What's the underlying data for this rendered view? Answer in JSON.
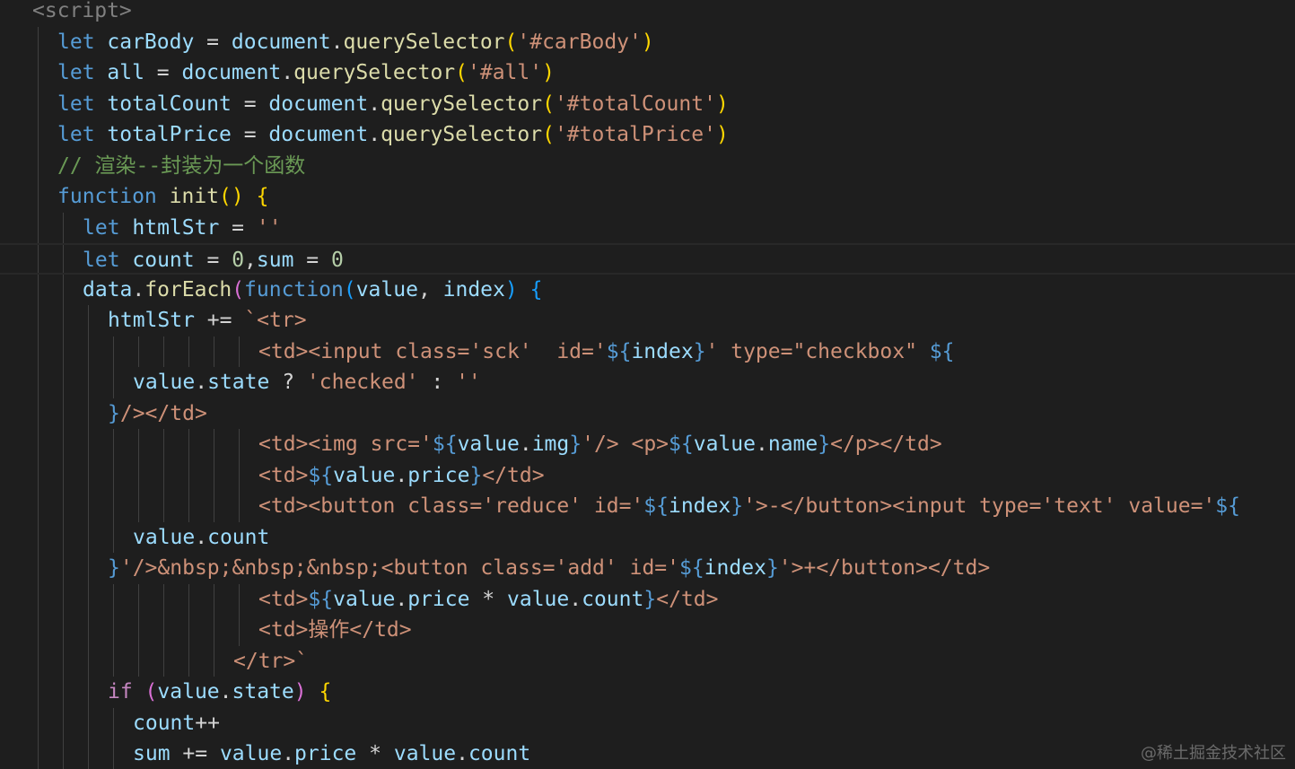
{
  "colors": {
    "background": "#1e1e1e",
    "tag": "#808080",
    "keyword": "#569cd6",
    "variable": "#9cdcfe",
    "function": "#dcdcaa",
    "string": "#ce9178",
    "number": "#b5cea8",
    "comment": "#6a9955",
    "bracket_gold": "#ffd700",
    "bracket_orchid": "#da70d6",
    "bracket_blue": "#179fff",
    "control": "#c586c0"
  },
  "watermark": "@稀土掘金技术社区",
  "current_line": 8,
  "lines": [
    {
      "indent": 1,
      "guides": [],
      "tokens": [
        [
          "tag",
          "<script>"
        ]
      ]
    },
    {
      "indent": 2,
      "guides": [
        1
      ],
      "tokens": [
        [
          "keyword",
          "let "
        ],
        [
          "var",
          "carBody"
        ],
        [
          "op",
          " = "
        ],
        [
          "var",
          "document"
        ],
        [
          "punc",
          "."
        ],
        [
          "func",
          "querySelector"
        ],
        [
          "brace",
          "("
        ],
        [
          "string",
          "'#carBody'"
        ],
        [
          "brace",
          ")"
        ]
      ]
    },
    {
      "indent": 2,
      "guides": [
        1
      ],
      "tokens": [
        [
          "keyword",
          "let "
        ],
        [
          "var",
          "all"
        ],
        [
          "op",
          " = "
        ],
        [
          "var",
          "document"
        ],
        [
          "punc",
          "."
        ],
        [
          "func",
          "querySelector"
        ],
        [
          "brace",
          "("
        ],
        [
          "string",
          "'#all'"
        ],
        [
          "brace",
          ")"
        ]
      ]
    },
    {
      "indent": 2,
      "guides": [
        1
      ],
      "tokens": [
        [
          "keyword",
          "let "
        ],
        [
          "var",
          "totalCount"
        ],
        [
          "op",
          " = "
        ],
        [
          "var",
          "document"
        ],
        [
          "punc",
          "."
        ],
        [
          "func",
          "querySelector"
        ],
        [
          "brace",
          "("
        ],
        [
          "string",
          "'#totalCount'"
        ],
        [
          "brace",
          ")"
        ]
      ]
    },
    {
      "indent": 2,
      "guides": [
        1
      ],
      "tokens": [
        [
          "keyword",
          "let "
        ],
        [
          "var",
          "totalPrice"
        ],
        [
          "op",
          " = "
        ],
        [
          "var",
          "document"
        ],
        [
          "punc",
          "."
        ],
        [
          "func",
          "querySelector"
        ],
        [
          "brace",
          "("
        ],
        [
          "string",
          "'#totalPrice'"
        ],
        [
          "brace",
          ")"
        ]
      ]
    },
    {
      "indent": 2,
      "guides": [
        1
      ],
      "tokens": [
        [
          "comment",
          "// 渲染--封装为一个函数"
        ]
      ]
    },
    {
      "indent": 2,
      "guides": [
        1
      ],
      "tokens": [
        [
          "keyword",
          "function "
        ],
        [
          "func",
          "init"
        ],
        [
          "brace",
          "()"
        ],
        [
          "punc",
          " "
        ],
        [
          "brace",
          "{"
        ]
      ]
    },
    {
      "indent": 3,
      "guides": [
        1,
        2
      ],
      "tokens": [
        [
          "keyword",
          "let "
        ],
        [
          "var",
          "htmlStr"
        ],
        [
          "op",
          " = "
        ],
        [
          "string",
          "''"
        ]
      ]
    },
    {
      "indent": 3,
      "guides": [
        1,
        2
      ],
      "tokens": [
        [
          "keyword",
          "let "
        ],
        [
          "var",
          "count"
        ],
        [
          "op",
          " = "
        ],
        [
          "number",
          "0"
        ],
        [
          "punc",
          ","
        ],
        [
          "var",
          "sum"
        ],
        [
          "op",
          " = "
        ],
        [
          "number",
          "0"
        ]
      ]
    },
    {
      "indent": 3,
      "guides": [
        1,
        2
      ],
      "tokens": [
        [
          "var",
          "data"
        ],
        [
          "punc",
          "."
        ],
        [
          "func",
          "forEach"
        ],
        [
          "paren",
          "("
        ],
        [
          "keyword",
          "function"
        ],
        [
          "paren2",
          "("
        ],
        [
          "var",
          "value"
        ],
        [
          "punc",
          ", "
        ],
        [
          "var",
          "index"
        ],
        [
          "paren2",
          ")"
        ],
        [
          "punc",
          " "
        ],
        [
          "paren2",
          "{"
        ]
      ]
    },
    {
      "indent": 4,
      "guides": [
        1,
        2,
        3
      ],
      "tokens": [
        [
          "var",
          "htmlStr"
        ],
        [
          "op",
          " += "
        ],
        [
          "string",
          "`<tr>"
        ]
      ]
    },
    {
      "indent": 10,
      "guides": [
        1,
        2,
        3,
        4,
        5,
        6,
        7,
        8,
        9
      ],
      "tokens": [
        [
          "string",
          "<td><input class='sck'  id='"
        ],
        [
          "interp",
          "${"
        ],
        [
          "var",
          "index"
        ],
        [
          "interp",
          "}"
        ],
        [
          "string",
          "' type=\"checkbox\" "
        ],
        [
          "interp",
          "${"
        ]
      ]
    },
    {
      "indent": 5,
      "guides": [
        1,
        2,
        3,
        4
      ],
      "tokens": [
        [
          "var",
          "value"
        ],
        [
          "punc",
          "."
        ],
        [
          "var",
          "state"
        ],
        [
          "op",
          " ? "
        ],
        [
          "string",
          "'checked'"
        ],
        [
          "op",
          " : "
        ],
        [
          "string",
          "''"
        ]
      ]
    },
    {
      "indent": 4,
      "guides": [
        1,
        2,
        3
      ],
      "tokens": [
        [
          "interp",
          "}"
        ],
        [
          "string",
          "/></td>"
        ]
      ]
    },
    {
      "indent": 10,
      "guides": [
        1,
        2,
        3,
        4,
        5,
        6,
        7,
        8,
        9
      ],
      "tokens": [
        [
          "string",
          "<td><img src='"
        ],
        [
          "interp",
          "${"
        ],
        [
          "var",
          "value"
        ],
        [
          "punc",
          "."
        ],
        [
          "var",
          "img"
        ],
        [
          "interp",
          "}"
        ],
        [
          "string",
          "'/> <p>"
        ],
        [
          "interp",
          "${"
        ],
        [
          "var",
          "value"
        ],
        [
          "punc",
          "."
        ],
        [
          "var",
          "name"
        ],
        [
          "interp",
          "}"
        ],
        [
          "string",
          "</p></td>"
        ]
      ]
    },
    {
      "indent": 10,
      "guides": [
        1,
        2,
        3,
        4,
        5,
        6,
        7,
        8,
        9
      ],
      "tokens": [
        [
          "string",
          "<td>"
        ],
        [
          "interp",
          "${"
        ],
        [
          "var",
          "value"
        ],
        [
          "punc",
          "."
        ],
        [
          "var",
          "price"
        ],
        [
          "interp",
          "}"
        ],
        [
          "string",
          "</td>"
        ]
      ]
    },
    {
      "indent": 10,
      "guides": [
        1,
        2,
        3,
        4,
        5,
        6,
        7,
        8,
        9
      ],
      "tokens": [
        [
          "string",
          "<td><button class='reduce' id='"
        ],
        [
          "interp",
          "${"
        ],
        [
          "var",
          "index"
        ],
        [
          "interp",
          "}"
        ],
        [
          "string",
          "'>-</button><input type='text' value='"
        ],
        [
          "interp",
          "${"
        ]
      ]
    },
    {
      "indent": 5,
      "guides": [
        1,
        2,
        3,
        4
      ],
      "tokens": [
        [
          "var",
          "value"
        ],
        [
          "punc",
          "."
        ],
        [
          "var",
          "count"
        ]
      ]
    },
    {
      "indent": 4,
      "guides": [
        1,
        2,
        3
      ],
      "tokens": [
        [
          "interp",
          "}"
        ],
        [
          "string",
          "'/>&nbsp;&nbsp;&nbsp;<button class='add' id='"
        ],
        [
          "interp",
          "${"
        ],
        [
          "var",
          "index"
        ],
        [
          "interp",
          "}"
        ],
        [
          "string",
          "'>+</button></td>"
        ]
      ]
    },
    {
      "indent": 10,
      "guides": [
        1,
        2,
        3,
        4,
        5,
        6,
        7,
        8,
        9
      ],
      "tokens": [
        [
          "string",
          "<td>"
        ],
        [
          "interp",
          "${"
        ],
        [
          "var",
          "value"
        ],
        [
          "punc",
          "."
        ],
        [
          "var",
          "price"
        ],
        [
          "op",
          " * "
        ],
        [
          "var",
          "value"
        ],
        [
          "punc",
          "."
        ],
        [
          "var",
          "count"
        ],
        [
          "interp",
          "}"
        ],
        [
          "string",
          "</td>"
        ]
      ]
    },
    {
      "indent": 10,
      "guides": [
        1,
        2,
        3,
        4,
        5,
        6,
        7,
        8,
        9
      ],
      "tokens": [
        [
          "string",
          "<td>操作</td>"
        ]
      ]
    },
    {
      "indent": 9,
      "guides": [
        1,
        2,
        3,
        4,
        5,
        6,
        7,
        8
      ],
      "tokens": [
        [
          "string",
          "</tr>`"
        ]
      ]
    },
    {
      "indent": 4,
      "guides": [
        1,
        2,
        3
      ],
      "tokens": [
        [
          "control",
          "if "
        ],
        [
          "paren",
          "("
        ],
        [
          "var",
          "value"
        ],
        [
          "punc",
          "."
        ],
        [
          "var",
          "state"
        ],
        [
          "paren",
          ")"
        ],
        [
          "punc",
          " "
        ],
        [
          "brace",
          "{"
        ]
      ]
    },
    {
      "indent": 5,
      "guides": [
        1,
        2,
        3,
        4
      ],
      "tokens": [
        [
          "var",
          "count"
        ],
        [
          "op",
          "++"
        ]
      ]
    },
    {
      "indent": 5,
      "guides": [
        1,
        2,
        3,
        4
      ],
      "tokens": [
        [
          "var",
          "sum"
        ],
        [
          "op",
          " += "
        ],
        [
          "var",
          "value"
        ],
        [
          "punc",
          "."
        ],
        [
          "var",
          "price"
        ],
        [
          "op",
          " * "
        ],
        [
          "var",
          "value"
        ],
        [
          "punc",
          "."
        ],
        [
          "var",
          "count"
        ]
      ]
    }
  ]
}
